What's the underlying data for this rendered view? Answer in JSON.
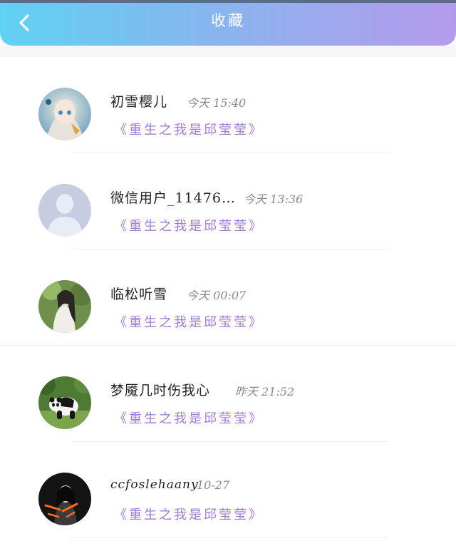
{
  "header": {
    "title": "收藏",
    "back_icon": "chevron-left-icon"
  },
  "colors": {
    "header_start": "#5fd2f3",
    "header_end": "#b59aec",
    "book_title": "#a07ad6"
  },
  "favorites": [
    {
      "name": "初雪樱儿",
      "time": "今天 15:40",
      "book": "《重生之我是邱莹莹》",
      "avatar": "anime-girl-avatar"
    },
    {
      "name": "微信用户_11476…",
      "time": "今天 13:36",
      "book": "《重生之我是邱莹莹》",
      "avatar": "default-user-avatar"
    },
    {
      "name": "临松听雪",
      "time": "今天 00:07",
      "book": "《重生之我是邱莹莹》",
      "avatar": "portrait-avatar"
    },
    {
      "name": "梦魇几时伤我心",
      "time": "昨天 21:52",
      "book": "《重生之我是邱莹莹》",
      "avatar": "panda-avatar"
    },
    {
      "name": "ccfoslehaany",
      "time": "10-27",
      "book": "《重生之我是邱莹莹》",
      "avatar": "dark-portrait-avatar"
    }
  ]
}
